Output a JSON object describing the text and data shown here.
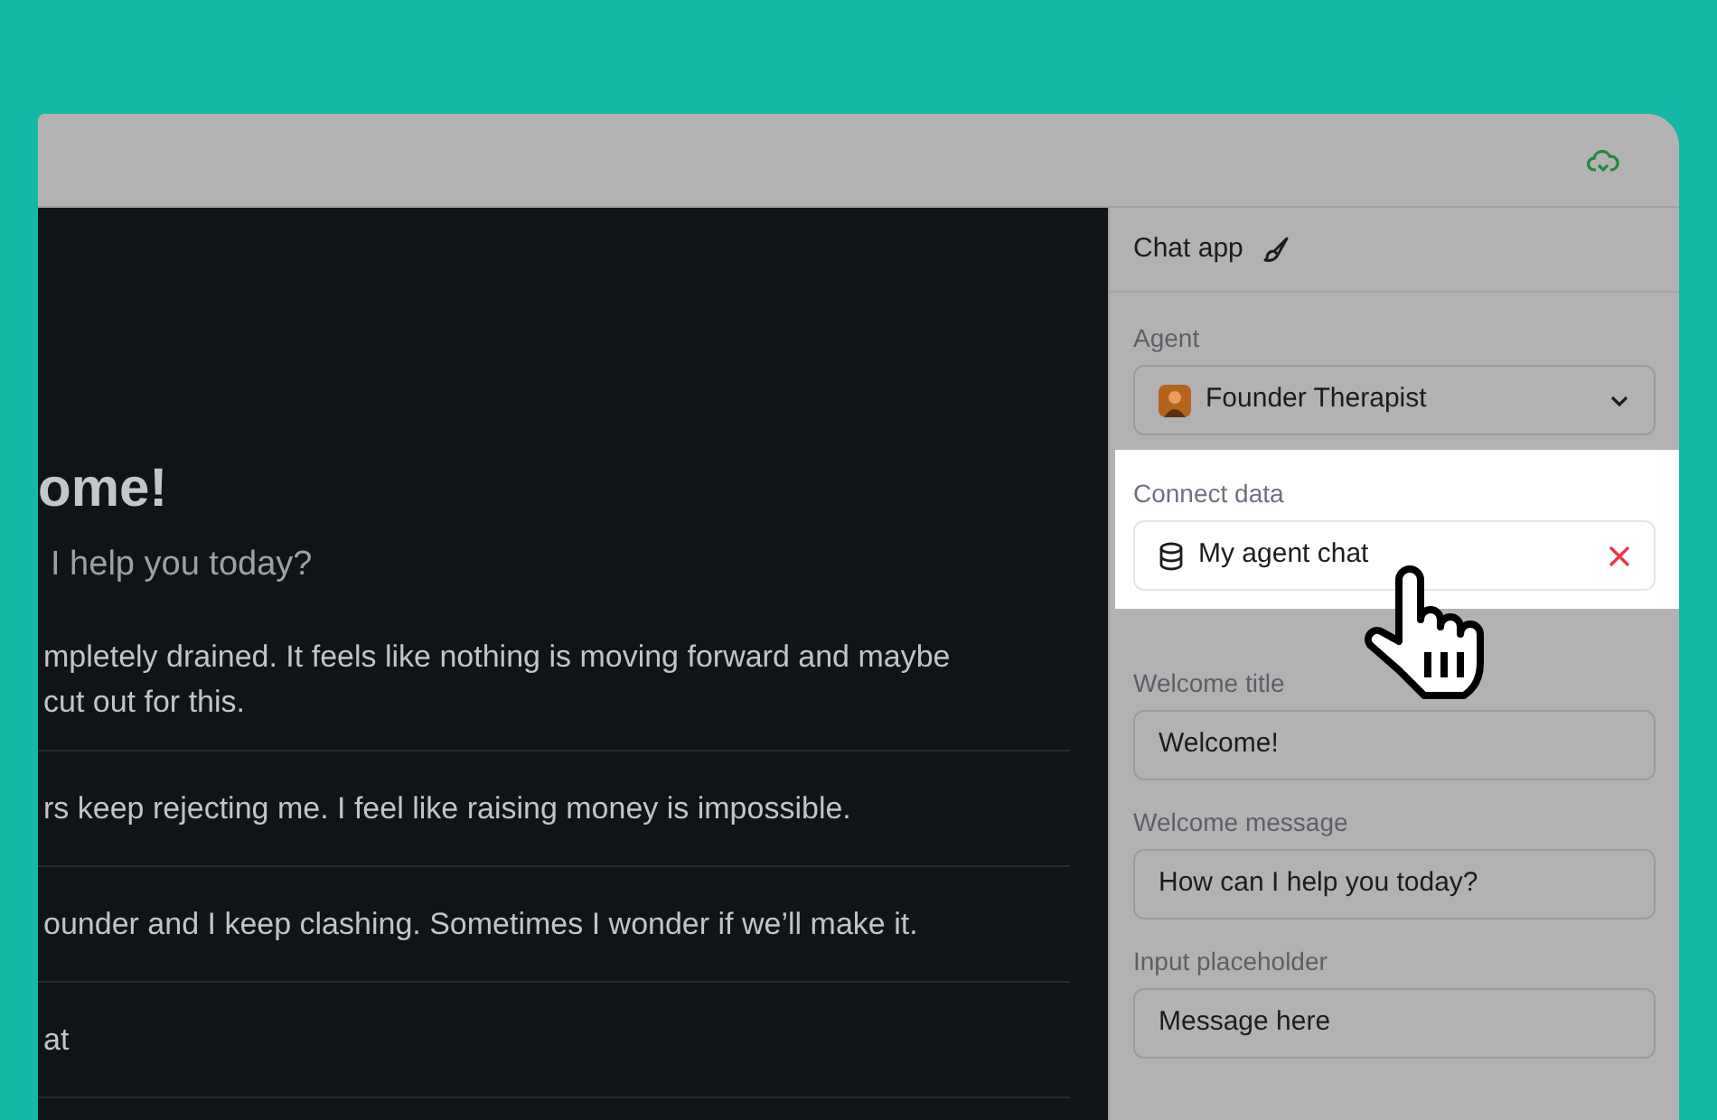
{
  "chat_preview": {
    "title": "ome!",
    "subtitle": "I help you today?",
    "suggestions": [
      {
        "lines": [
          "mpletely drained. It feels like nothing is moving forward and maybe",
          "cut out for this."
        ]
      },
      {
        "lines": [
          "rs keep rejecting me. I feel like raising money is impossible."
        ]
      },
      {
        "lines": [
          "ounder and I keep clashing. Sometimes I wonder if we’ll make it."
        ]
      },
      {
        "lines": [
          "at"
        ]
      }
    ]
  },
  "settings_panel": {
    "title": "Chat app",
    "fields": [
      {
        "kind": "select",
        "label": "Agent",
        "value": "Founder Therapist",
        "highlighted": false
      },
      {
        "kind": "data",
        "label": "Connect data",
        "value": "My agent chat",
        "highlighted": true
      },
      {
        "kind": "text",
        "label": "Welcome title",
        "value": "Welcome!",
        "highlighted": false
      },
      {
        "kind": "text",
        "label": "Welcome message",
        "value": "How can I help you today?",
        "highlighted": false
      },
      {
        "kind": "text",
        "label": "Input placeholder",
        "value": "Message here",
        "highlighted": false
      }
    ]
  }
}
